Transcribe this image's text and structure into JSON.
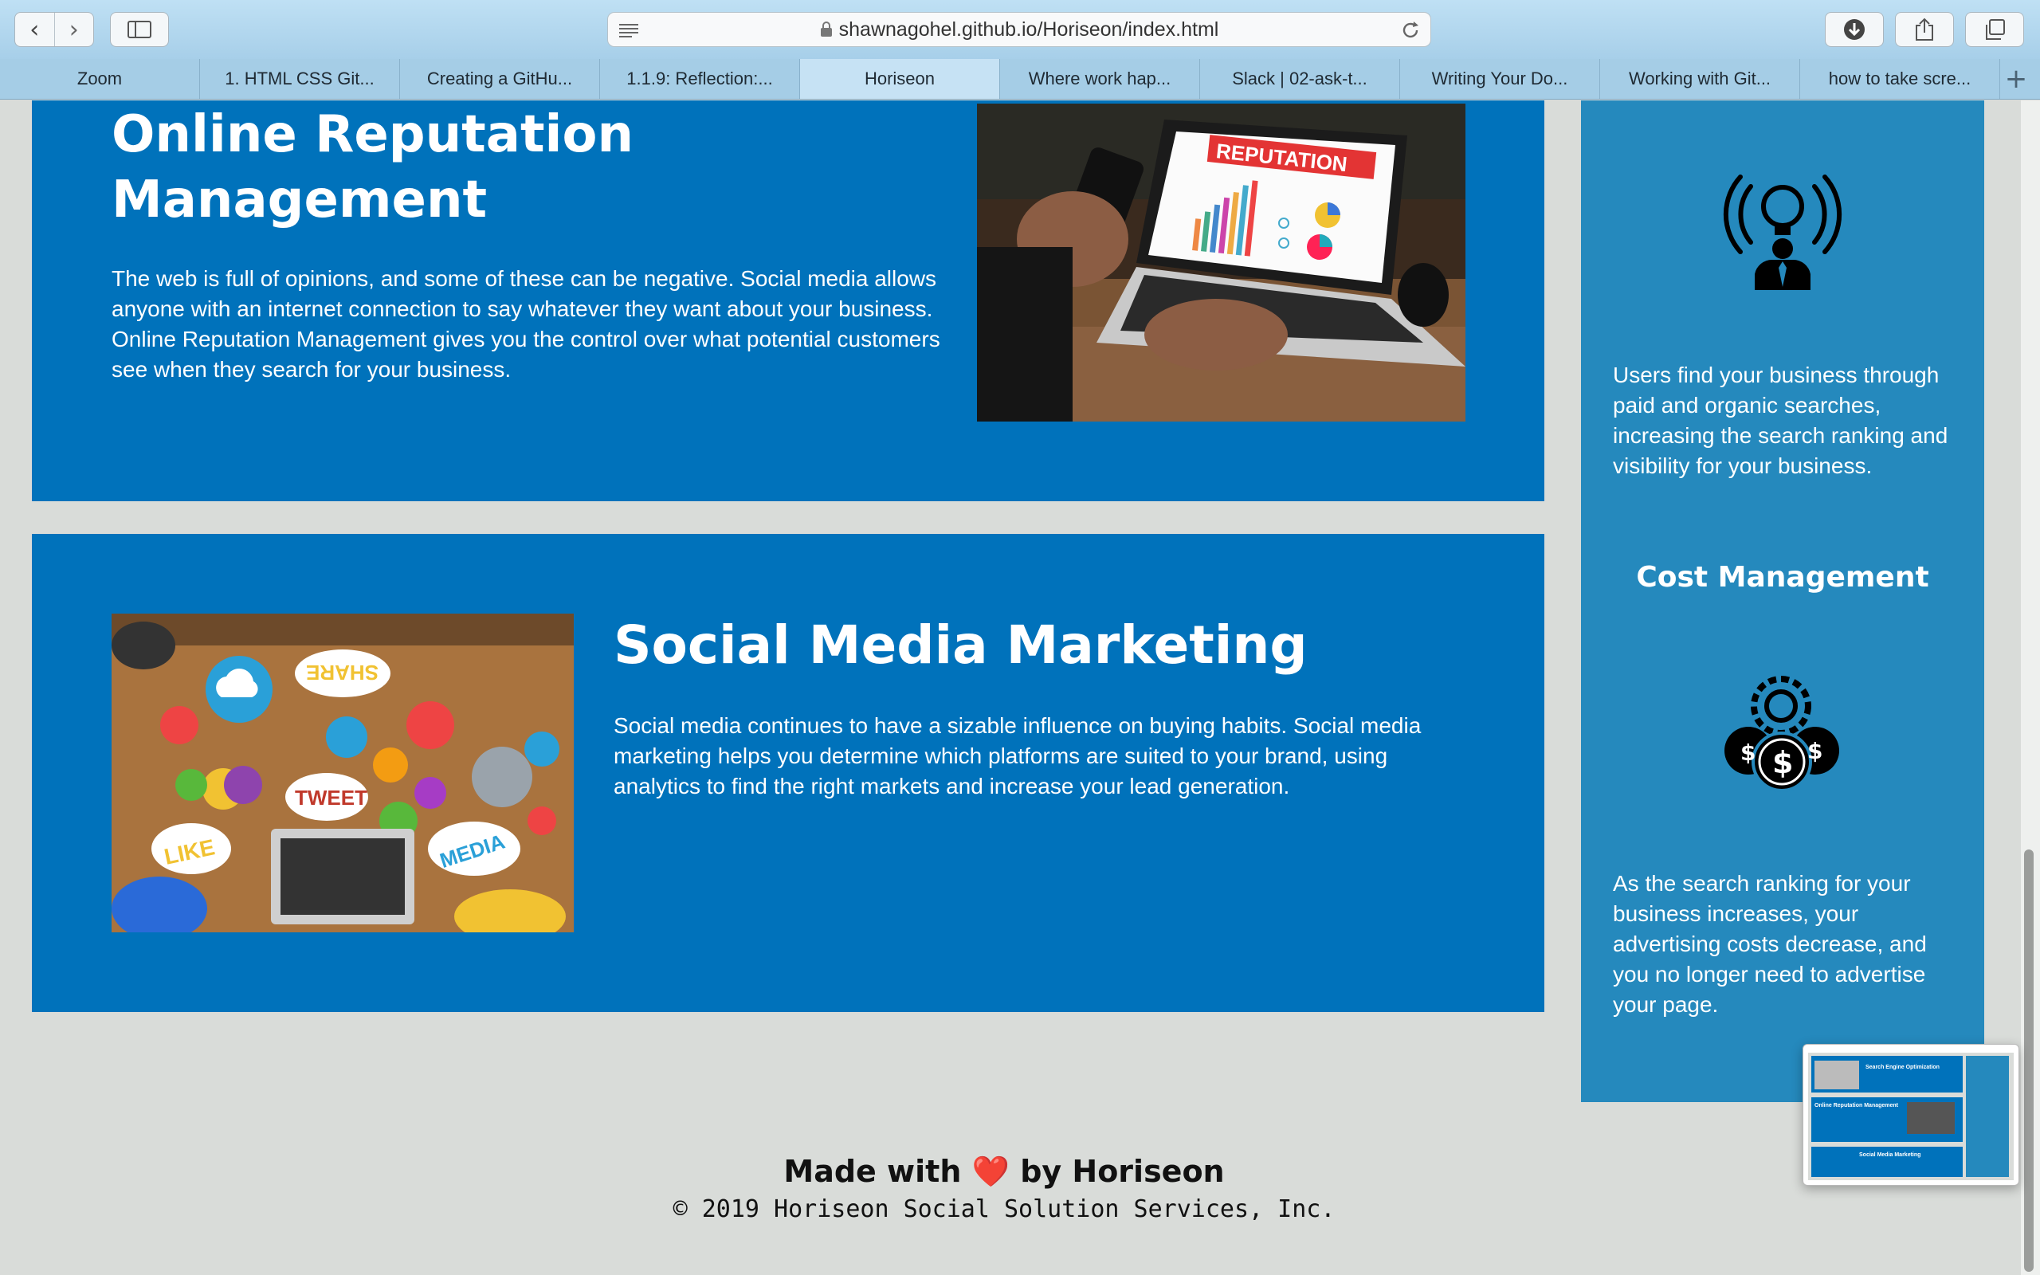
{
  "browser": {
    "url": "shawnagohel.github.io/Horiseon/index.html",
    "tabs": [
      {
        "label": "Zoom",
        "active": false
      },
      {
        "label": "1. HTML CSS Git...",
        "active": false
      },
      {
        "label": "Creating a GitHu...",
        "active": false
      },
      {
        "label": "1.1.9: Reflection:...",
        "active": false
      },
      {
        "label": "Horiseon",
        "active": true
      },
      {
        "label": "Where work hap...",
        "active": false
      },
      {
        "label": "Slack | 02-ask-t...",
        "active": false
      },
      {
        "label": "Writing Your Do...",
        "active": false
      },
      {
        "label": "Working with Git...",
        "active": false
      },
      {
        "label": "how to take scre...",
        "active": false
      }
    ]
  },
  "main": {
    "reputation": {
      "title": "Online Reputation Management",
      "text": "The web is full of opinions, and some of these can be negative. Social media allows anyone with an internet connection to say whatever they want about your business. Online Reputation Management gives you the control over what potential customers see when they search for your business.",
      "image_label": "REPUTATION"
    },
    "social": {
      "title": "Social Media Marketing",
      "text": "Social media continues to have a sizable influence on buying habits. Social media marketing helps you determine which platforms are suited to your brand, using analytics to find the right markets and increase your lead generation.",
      "image_words": {
        "share": "SHARE",
        "tweet": "TWEET",
        "like": "LIKE",
        "media": "MEDIA"
      }
    }
  },
  "sidebar": {
    "lead_text": "Users find your business through paid and organic searches, increasing the search ranking and visibility for your business.",
    "cost_title": "Cost Management",
    "cost_text": "As the search ranking for your business increases, your advertising costs decrease, and you no longer need to advertise your page."
  },
  "footer": {
    "made_prefix": "Made with",
    "heart": "❤️",
    "made_suffix": "by Horiseon",
    "copyright": "© 2019 Horiseon Social Solution Services, Inc."
  },
  "preview": {
    "seo_title": "Search Engine Optimization",
    "orm_title": "Online Reputation Management",
    "smm_title": "Social Media Marketing"
  },
  "colors": {
    "card_blue": "#0072bb",
    "sidebar_blue": "#2589bd",
    "page_bg": "#d9dcd9"
  }
}
